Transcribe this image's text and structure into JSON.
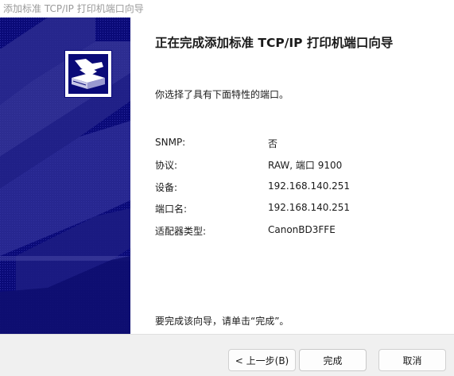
{
  "window": {
    "title": "添加标准 TCP/IP 打印机端口向导"
  },
  "banner": {
    "logo_icon": "printer-wizard-icon",
    "background_color": "#0a0a78"
  },
  "main": {
    "heading": "正在完成添加标准 TCP/IP 打印机端口向导",
    "intro": "你选择了具有下面特性的端口。",
    "properties": [
      {
        "label": "SNMP:",
        "value": "否"
      },
      {
        "label": "协议:",
        "value": "RAW, 端口 9100"
      },
      {
        "label": "设备:",
        "value": "192.168.140.251"
      },
      {
        "label": "端口名:",
        "value": "192.168.140.251"
      },
      {
        "label": "适配器类型:",
        "value": "CanonBD3FFE"
      }
    ],
    "finish_note": "要完成该向导，请单击“完成”。"
  },
  "buttons": {
    "back_label": "< 上一步(B)",
    "finish_label": "完成",
    "cancel_label": "取消"
  }
}
